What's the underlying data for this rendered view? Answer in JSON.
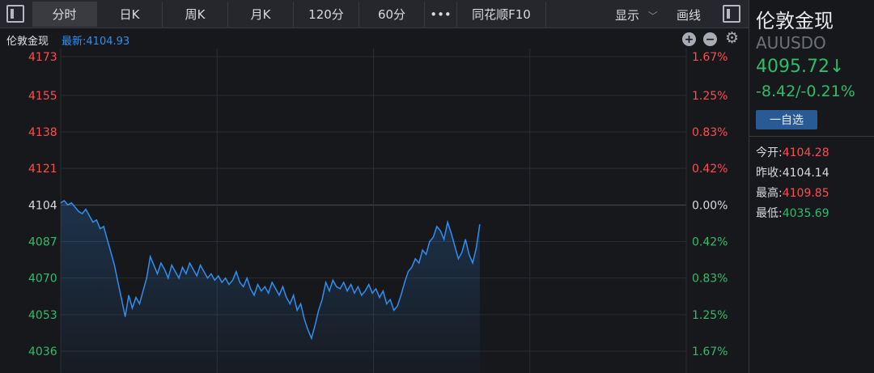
{
  "toolbar": {
    "tabs": [
      {
        "label": "分时",
        "active": true
      },
      {
        "label": "日K"
      },
      {
        "label": "周K"
      },
      {
        "label": "月K"
      },
      {
        "label": "120分"
      },
      {
        "label": "60分"
      },
      {
        "label": "•••"
      },
      {
        "label": "同花顺F10"
      }
    ],
    "display_label": "显示",
    "display_caret": "﹀",
    "draw_label": "画线"
  },
  "chart_header": {
    "name": "伦敦金现",
    "latest_label": "最新",
    "latest_value": "4104.93"
  },
  "quote": {
    "name": "伦敦金现",
    "code": "AUUSDO",
    "price": "4095.72",
    "arrow": "↓",
    "change": "-8.42/-0.21%",
    "watch_button": "一自选",
    "stats": [
      {
        "label": "今开:",
        "value": "4104.28",
        "color": "#ff4d4f"
      },
      {
        "label": "昨收:",
        "value": "4104.14",
        "color": "#d8dadf"
      },
      {
        "label": "最高:",
        "value": "4109.85",
        "color": "#ff4d4f"
      },
      {
        "label": "最低:",
        "value": "4035.69",
        "color": "#2ebd6a"
      }
    ]
  },
  "colors": {
    "up": "#ff4d4f",
    "down": "#2ebd6a",
    "line": "#2f8ff0",
    "accent": "#2f8ff0"
  },
  "chart_data": {
    "type": "line",
    "baseline": 4104.14,
    "ylim": [
      4036,
      4173
    ],
    "y_ticks_left": [
      {
        "label": "4173",
        "value": 4173,
        "side": "up"
      },
      {
        "label": "4155",
        "value": 4155,
        "side": "up"
      },
      {
        "label": "4138",
        "value": 4138,
        "side": "up"
      },
      {
        "label": "4121",
        "value": 4121,
        "side": "up"
      },
      {
        "label": "4104",
        "value": 4104,
        "side": "flat"
      },
      {
        "label": "4087",
        "value": 4087,
        "side": "down"
      },
      {
        "label": "4070",
        "value": 4070,
        "side": "down"
      },
      {
        "label": "4053",
        "value": 4053,
        "side": "down"
      },
      {
        "label": "4036",
        "value": 4036,
        "side": "down"
      }
    ],
    "y_ticks_right": [
      {
        "label": "1.67%",
        "value": 4173,
        "side": "up"
      },
      {
        "label": "1.25%",
        "value": 4155,
        "side": "up"
      },
      {
        "label": "0.83%",
        "value": 4138,
        "side": "up"
      },
      {
        "label": "0.42%",
        "value": 4121,
        "side": "up"
      },
      {
        "label": "0.00%",
        "value": 4104,
        "side": "flat"
      },
      {
        "label": "0.42%",
        "value": 4087,
        "side": "down"
      },
      {
        "label": "0.83%",
        "value": 4070,
        "side": "down"
      },
      {
        "label": "1.25%",
        "value": 4053,
        "side": "down"
      },
      {
        "label": "1.67%",
        "value": 4036,
        "side": "down"
      }
    ],
    "grid": true,
    "session_fraction": 0.67,
    "series": [
      {
        "values": [
          4105,
          4106,
          4104,
          4105,
          4103,
          4101,
          4100,
          4102,
          4099,
          4096,
          4097,
          4093,
          4094,
          4088,
          4082,
          4076,
          4068,
          4060,
          4052,
          4062,
          4056,
          4061,
          4058,
          4064,
          4070,
          4080,
          4076,
          4072,
          4077,
          4074,
          4070,
          4076,
          4073,
          4070,
          4075,
          4072,
          4077,
          4074,
          4071,
          4076,
          4073,
          4070,
          4072,
          4069,
          4071,
          4068,
          4070,
          4067,
          4069,
          4073,
          4068,
          4066,
          4070,
          4065,
          4062,
          4067,
          4064,
          4066,
          4063,
          4068,
          4065,
          4062,
          4066,
          4061,
          4058,
          4062,
          4055,
          4058,
          4051,
          4046,
          4042,
          4048,
          4055,
          4060,
          4068,
          4064,
          4069,
          4066,
          4065,
          4068,
          4064,
          4067,
          4063,
          4066,
          4062,
          4064,
          4067,
          4063,
          4065,
          4061,
          4064,
          4058,
          4060,
          4055,
          4057,
          4062,
          4068,
          4073,
          4075,
          4079,
          4077,
          4083,
          4081,
          4087,
          4089,
          4094,
          4092,
          4088,
          4096,
          4091,
          4085,
          4079,
          4082,
          4088,
          4081,
          4077,
          4084,
          4095
        ]
      }
    ]
  }
}
